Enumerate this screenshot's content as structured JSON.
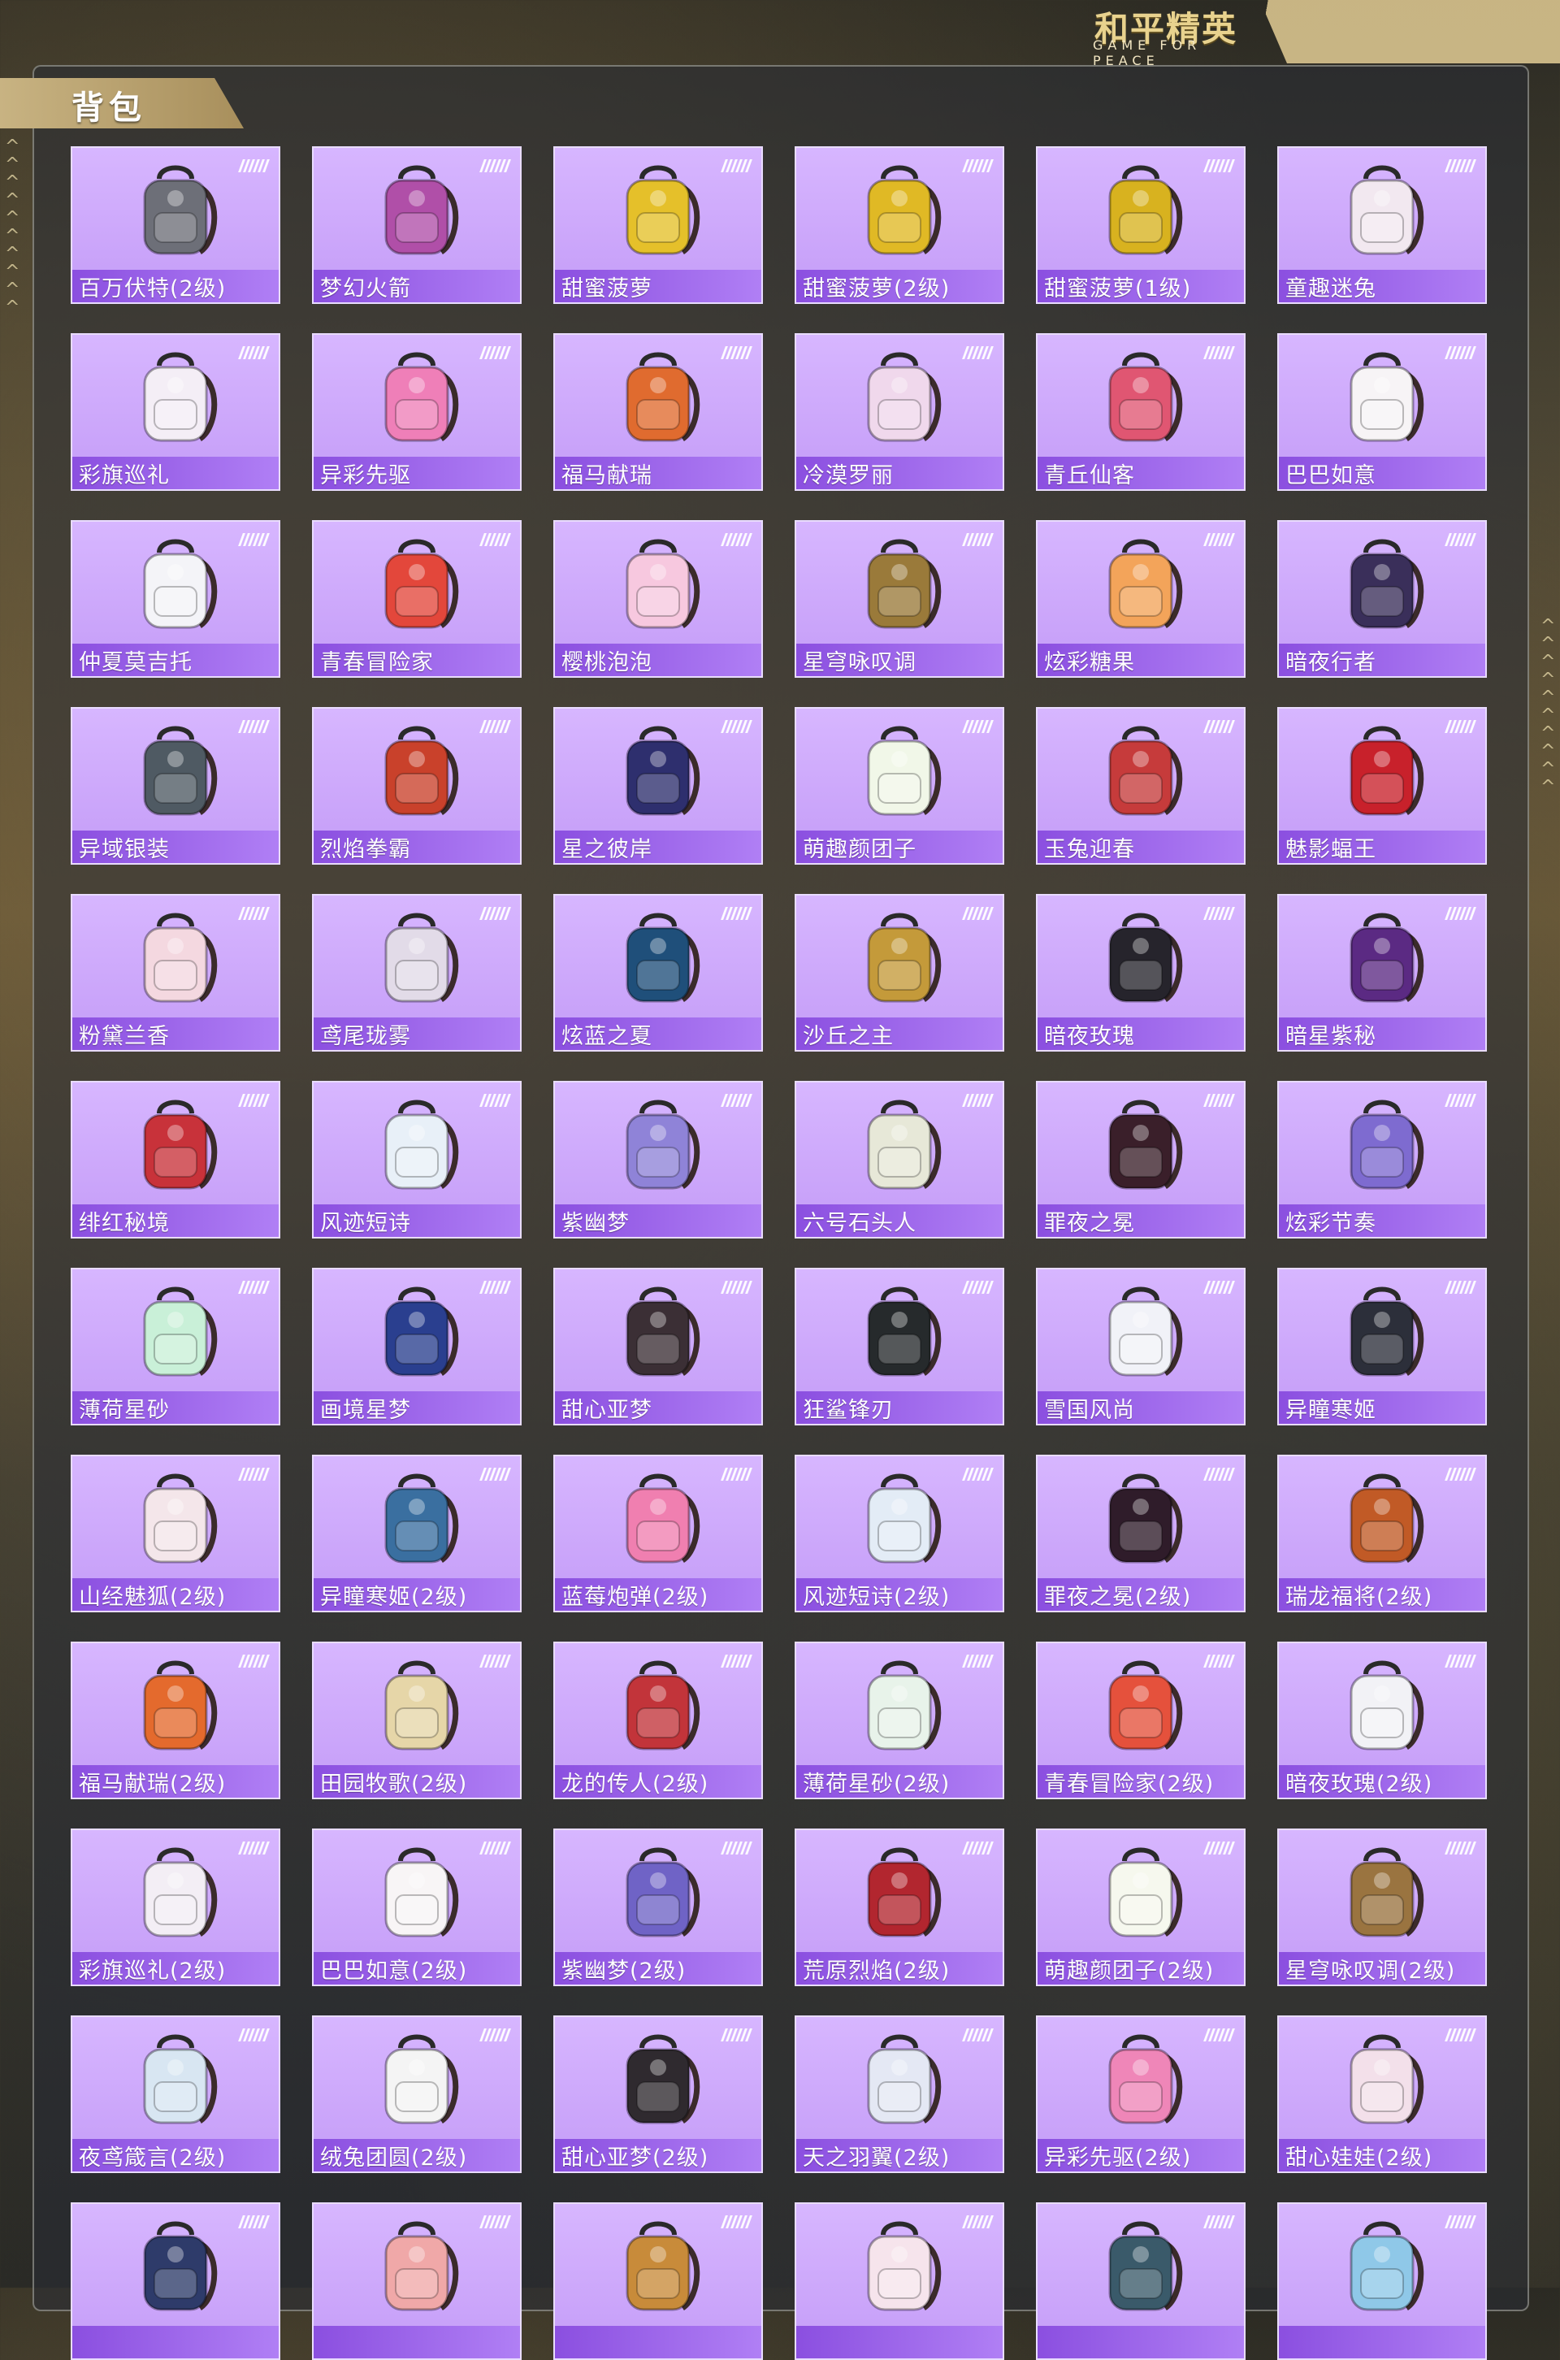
{
  "header": {
    "logo_cn": "和平精英",
    "logo_en": "GAME FOR PEACE"
  },
  "section": {
    "title": "背包"
  },
  "colors": {
    "card_bg": "#c49cf7",
    "label_bar": "#8b4fe0",
    "accent_gold": "#c8b382"
  },
  "items": [
    {
      "label": "百万伏特(2级)",
      "icon": "backpack-icon",
      "color": "#6d6f78"
    },
    {
      "label": "梦幻火箭",
      "icon": "backpack-icon",
      "color": "#b04fa8"
    },
    {
      "label": "甜蜜菠萝",
      "icon": "pineapple-backpack-icon",
      "color": "#e5c02a"
    },
    {
      "label": "甜蜜菠萝(2级)",
      "icon": "pineapple-backpack-icon",
      "color": "#e0b925"
    },
    {
      "label": "甜蜜菠萝(1级)",
      "icon": "pineapple-backpack-icon",
      "color": "#d8b21f"
    },
    {
      "label": "童趣迷兔",
      "icon": "rabbit-backpack-icon",
      "color": "#f2e8f0"
    },
    {
      "label": "彩旗巡礼",
      "icon": "plush-backpack-icon",
      "color": "#f4eef6"
    },
    {
      "label": "异彩先驱",
      "icon": "backpack-icon",
      "color": "#ef7fb8"
    },
    {
      "label": "福马献瑞",
      "icon": "horse-backpack-icon",
      "color": "#e06b2f"
    },
    {
      "label": "冷漠罗丽",
      "icon": "heart-backpack-icon",
      "color": "#f0d8ec"
    },
    {
      "label": "青丘仙客",
      "icon": "fox-backpack-icon",
      "color": "#e05672"
    },
    {
      "label": "巴巴如意",
      "icon": "rabbit-backpack-icon",
      "color": "#f7f4f6"
    },
    {
      "label": "仲夏莫吉托",
      "icon": "cup-backpack-icon",
      "color": "#f4f4f8"
    },
    {
      "label": "青春冒险家",
      "icon": "dino-backpack-icon",
      "color": "#e3473b"
    },
    {
      "label": "樱桃泡泡",
      "icon": "bow-backpack-icon",
      "color": "#f7c8df"
    },
    {
      "label": "星穹咏叹调",
      "icon": "frame-backpack-icon",
      "color": "#9a7a3a"
    },
    {
      "label": "炫彩糖果",
      "icon": "donut-backpack-icon",
      "color": "#f3a45a"
    },
    {
      "label": "暗夜行者",
      "icon": "backpack-icon",
      "color": "#3a2f5a"
    },
    {
      "label": "异域银装",
      "icon": "backpack-icon",
      "color": "#4f5a63"
    },
    {
      "label": "烈焰拳霸",
      "icon": "mask-backpack-icon",
      "color": "#c9412b"
    },
    {
      "label": "星之彼岸",
      "icon": "backpack-icon",
      "color": "#2e2f6e"
    },
    {
      "label": "萌趣颜团子",
      "icon": "plush-backpack-icon",
      "color": "#f1f7e8"
    },
    {
      "label": "玉兔迎春",
      "icon": "backpack-icon",
      "color": "#c63b3b"
    },
    {
      "label": "魅影蝠王",
      "icon": "pouch-backpack-icon",
      "color": "#c8212b"
    },
    {
      "label": "粉黛兰香",
      "icon": "pouch-backpack-icon",
      "color": "#f4d8e0"
    },
    {
      "label": "鸢尾珑雾",
      "icon": "pouch-backpack-icon",
      "color": "#e2dbe8"
    },
    {
      "label": "炫蓝之夏",
      "icon": "backpack-icon",
      "color": "#1f4f7a"
    },
    {
      "label": "沙丘之主",
      "icon": "scroll-backpack-icon",
      "color": "#c49a3a"
    },
    {
      "label": "暗夜玫瑰",
      "icon": "plush-backpack-icon",
      "color": "#26242c"
    },
    {
      "label": "暗星紫秘",
      "icon": "crest-backpack-icon",
      "color": "#5b2a83"
    },
    {
      "label": "绯红秘境",
      "icon": "backpack-icon",
      "color": "#c8323a"
    },
    {
      "label": "风迹短诗",
      "icon": "box-backpack-icon",
      "color": "#e8f0f8"
    },
    {
      "label": "紫幽梦",
      "icon": "rabbit-backpack-icon",
      "color": "#8f83d8"
    },
    {
      "label": "六号石头人",
      "icon": "plush-backpack-icon",
      "color": "#e7e8d8"
    },
    {
      "label": "罪夜之冕",
      "icon": "backpack-icon",
      "color": "#3a1f2a"
    },
    {
      "label": "炫彩节奏",
      "icon": "backpack-icon",
      "color": "#7e6bd0"
    },
    {
      "label": "薄荷星砂",
      "icon": "pouch-backpack-icon",
      "color": "#c9f0d8"
    },
    {
      "label": "画境星梦",
      "icon": "frame-backpack-icon",
      "color": "#2a3f8f"
    },
    {
      "label": "甜心亚梦",
      "icon": "backpack-icon",
      "color": "#3b2f35"
    },
    {
      "label": "狂鲨锋刃",
      "icon": "shark-backpack-icon",
      "color": "#262a2c"
    },
    {
      "label": "雪国风尚",
      "icon": "plush-backpack-icon",
      "color": "#f1f2f8"
    },
    {
      "label": "异瞳寒姬",
      "icon": "plush-backpack-icon",
      "color": "#2c2f3a"
    },
    {
      "label": "山经魅狐(2级)",
      "icon": "fox-backpack-icon",
      "color": "#f4e6ea"
    },
    {
      "label": "异瞳寒姬(2级)",
      "icon": "backpack-icon",
      "color": "#3a6fa0"
    },
    {
      "label": "蓝莓炮弹(2级)",
      "icon": "cake-backpack-icon",
      "color": "#f07fb0"
    },
    {
      "label": "风迹短诗(2级)",
      "icon": "box-backpack-icon",
      "color": "#e3ecf6"
    },
    {
      "label": "罪夜之冕(2级)",
      "icon": "backpack-icon",
      "color": "#2f1c2a"
    },
    {
      "label": "瑞龙福将(2级)",
      "icon": "mask-backpack-icon",
      "color": "#c15a26"
    },
    {
      "label": "福马献瑞(2级)",
      "icon": "horse-backpack-icon",
      "color": "#e46a2d"
    },
    {
      "label": "田园牧歌(2级)",
      "icon": "basket-backpack-icon",
      "color": "#e6d6a8"
    },
    {
      "label": "龙的传人(2级)",
      "icon": "backpack-icon",
      "color": "#c2343a"
    },
    {
      "label": "薄荷星砂(2级)",
      "icon": "box-backpack-icon",
      "color": "#e8f3ea"
    },
    {
      "label": "青春冒险家(2级)",
      "icon": "dino-backpack-icon",
      "color": "#e5513c"
    },
    {
      "label": "暗夜玫瑰(2级)",
      "icon": "plush-backpack-icon",
      "color": "#f2f2f6"
    },
    {
      "label": "彩旗巡礼(2级)",
      "icon": "plush-backpack-icon",
      "color": "#f3eef5"
    },
    {
      "label": "巴巴如意(2级)",
      "icon": "rabbit-backpack-icon",
      "color": "#f8f5f6"
    },
    {
      "label": "紫幽梦(2级)",
      "icon": "rabbit-backpack-icon",
      "color": "#6f63c6"
    },
    {
      "label": "荒原烈焰(2级)",
      "icon": "backpack-icon",
      "color": "#b2262f"
    },
    {
      "label": "萌趣颜团子(2级)",
      "icon": "plush-backpack-icon",
      "color": "#f6f8ee"
    },
    {
      "label": "星穹咏叹调(2级)",
      "icon": "frame-backpack-icon",
      "color": "#9a7440"
    },
    {
      "label": "夜鸢箴言(2级)",
      "icon": "crest-backpack-icon",
      "color": "#d8e6f2"
    },
    {
      "label": "绒兔团圆(2级)",
      "icon": "rabbit-backpack-icon",
      "color": "#f4f4f4"
    },
    {
      "label": "甜心亚梦(2级)",
      "icon": "backpack-icon",
      "color": "#2f2a2f"
    },
    {
      "label": "天之羽翼(2级)",
      "icon": "crest-backpack-icon",
      "color": "#e4e8f4"
    },
    {
      "label": "异彩先驱(2级)",
      "icon": "backpack-icon",
      "color": "#ef86b8"
    },
    {
      "label": "甜心娃娃(2级)",
      "icon": "plush-backpack-icon",
      "color": "#f3e0ea"
    },
    {
      "label": "",
      "icon": "book-backpack-icon",
      "color": "#2e3b6a"
    },
    {
      "label": "",
      "icon": "backpack-icon",
      "color": "#f0a8a8"
    },
    {
      "label": "",
      "icon": "mask-backpack-icon",
      "color": "#c88b3a"
    },
    {
      "label": "",
      "icon": "cup-backpack-icon",
      "color": "#f6e4ec"
    },
    {
      "label": "",
      "icon": "backpack-icon",
      "color": "#3a5a6a"
    },
    {
      "label": "",
      "icon": "plush-backpack-icon",
      "color": "#8fc8e8"
    }
  ]
}
